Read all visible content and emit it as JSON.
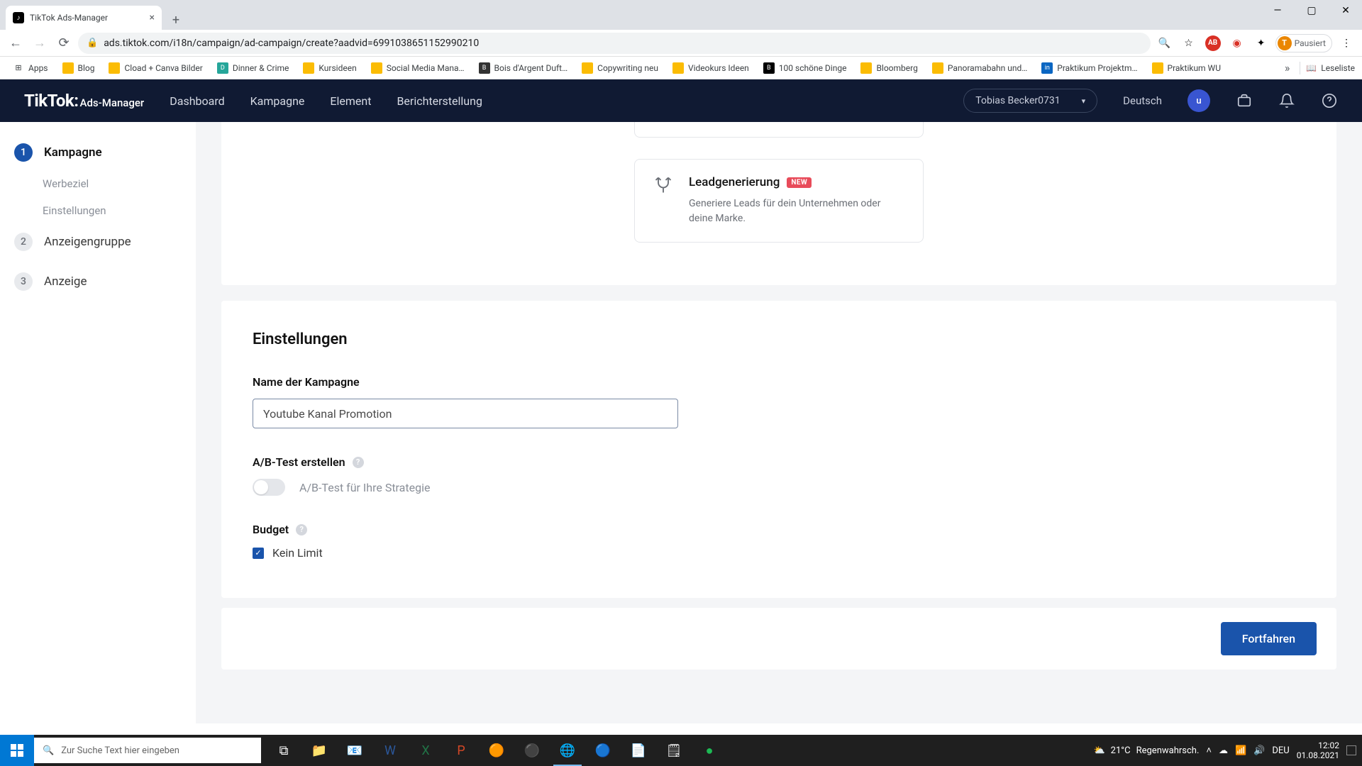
{
  "browser": {
    "tab_title": "TikTok Ads-Manager",
    "url": "ads.tiktok.com/i18n/campaign/ad-campaign/create?aadvid=6991038651152990210",
    "profile_status": "Pausiert",
    "bookmarks": [
      "Apps",
      "Blog",
      "Cload + Canva Bilder",
      "Dinner & Crime",
      "Kursideen",
      "Social Media Mana…",
      "Bois d'Argent Duft…",
      "Copywriting neu",
      "Videokurs Ideen",
      "100 schöne Dinge",
      "Bloomberg",
      "Panoramabahn und…",
      "Praktikum Projektm…",
      "Praktikum WU"
    ],
    "reading_list": "Leseliste"
  },
  "header": {
    "logo_main": "TikTok:",
    "logo_sub": "Ads-Manager",
    "nav": [
      "Dashboard",
      "Kampagne",
      "Element",
      "Berichterstellung"
    ],
    "user": "Tobias Becker0731",
    "lang": "Deutsch",
    "avatar_letter": "u"
  },
  "sidebar": {
    "steps": [
      {
        "num": "1",
        "label": "Kampagne",
        "active": true,
        "sub": [
          "Werbeziel",
          "Einstellungen"
        ]
      },
      {
        "num": "2",
        "label": "Anzeigengruppe",
        "active": false
      },
      {
        "num": "3",
        "label": "Anzeige",
        "active": false
      }
    ]
  },
  "lead_card": {
    "title": "Leadgenerierung",
    "badge": "NEW",
    "desc": "Generiere Leads für dein Unternehmen oder deine Marke."
  },
  "settings": {
    "title": "Einstellungen",
    "name_label": "Name der Kampagne",
    "name_value": "Youtube Kanal Promotion",
    "ab_label": "A/B-Test erstellen",
    "ab_sub": "A/B-Test für Ihre Strategie",
    "budget_label": "Budget",
    "budget_check": "Kein Limit"
  },
  "footer": {
    "continue": "Fortfahren"
  },
  "taskbar": {
    "search_placeholder": "Zur Suche Text hier eingeben",
    "weather_temp": "21°C",
    "weather_text": "Regenwahrsch.",
    "lang": "DEU",
    "time": "12:02",
    "date": "01.08.2021"
  }
}
